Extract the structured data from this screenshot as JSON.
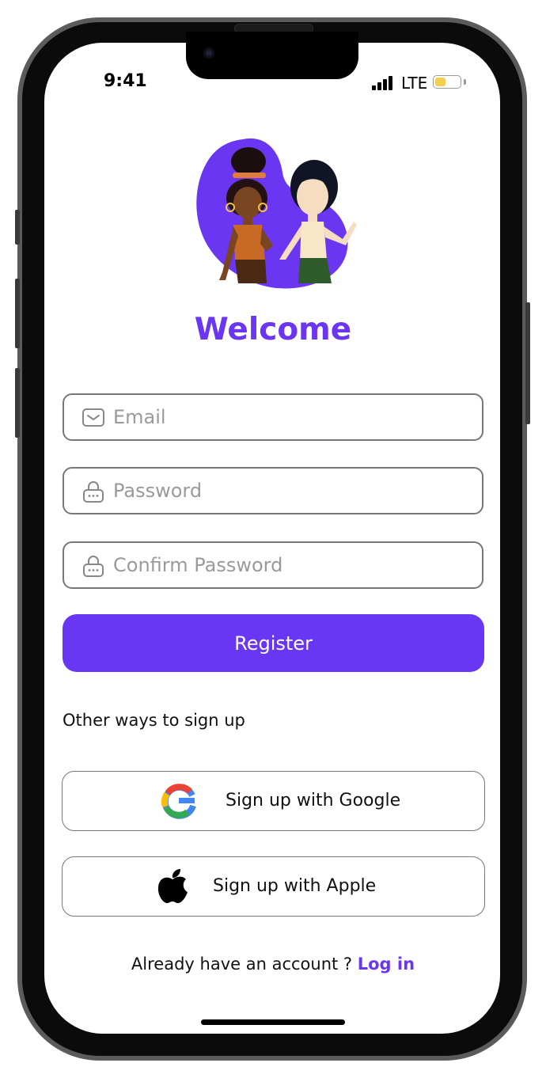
{
  "status_bar": {
    "time": "9:41",
    "network": "LTE",
    "battery_level": 0.45
  },
  "hero": {
    "title": "Welcome"
  },
  "form": {
    "email": {
      "placeholder": "Email",
      "value": "",
      "icon": "envelope-icon"
    },
    "password": {
      "placeholder": "Password",
      "value": "",
      "icon": "lock-icon"
    },
    "confirm_password": {
      "placeholder": "Confirm Password",
      "value": "",
      "icon": "lock-icon"
    },
    "register_label": "Register"
  },
  "social": {
    "heading": "Other ways to sign up",
    "google_label": "Sign up with Google",
    "apple_label": "Sign up with Apple"
  },
  "footer": {
    "prompt": "Already have an account ?",
    "login_label": "Log in"
  },
  "colors": {
    "accent": "#6A36F1",
    "blob": "#6A36F1",
    "battery": "#F2CF4E"
  }
}
